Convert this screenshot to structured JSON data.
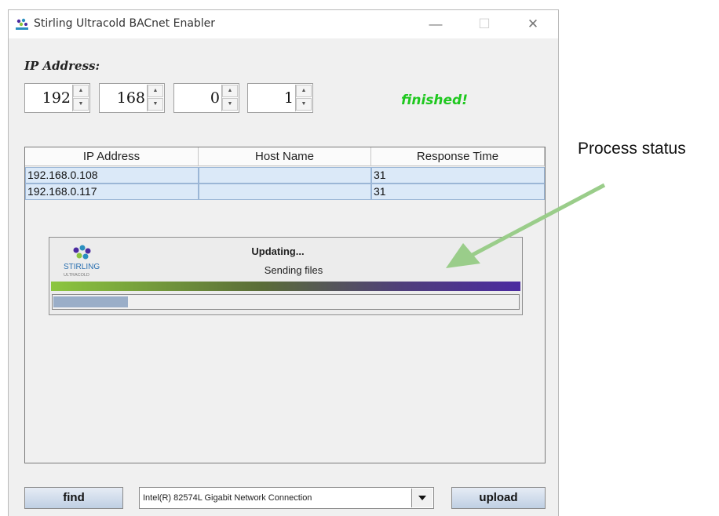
{
  "window": {
    "title": "Stirling Ultracold BACnet Enabler",
    "icon": "stirling-logo-icon",
    "controls": [
      "minimize-icon",
      "maximize-icon",
      "close-icon"
    ]
  },
  "ip": {
    "label": "IP Address:",
    "octets": [
      "192",
      "168",
      "0",
      "1"
    ]
  },
  "status": {
    "text": "finished!",
    "color": "#1fc81f"
  },
  "table": {
    "headers": [
      "IP Address",
      "Host Name",
      "Response Time"
    ],
    "rows": [
      [
        "192.168.0.108",
        "",
        "31"
      ],
      [
        "192.168.0.117",
        "",
        "31"
      ]
    ]
  },
  "dialog": {
    "heading": "Updating...",
    "message": "Sending files",
    "logo_text": "STIRLING",
    "logo_subtext": "ULTRACOLD",
    "progress": 0.16
  },
  "footer": {
    "find_label": "find",
    "adapter_selected": "Intel(R) 82574L Gigabit Network Connection",
    "upload_label": "upload"
  },
  "annotation": {
    "text": "Process status",
    "arrow_color": "#9acd8a"
  }
}
